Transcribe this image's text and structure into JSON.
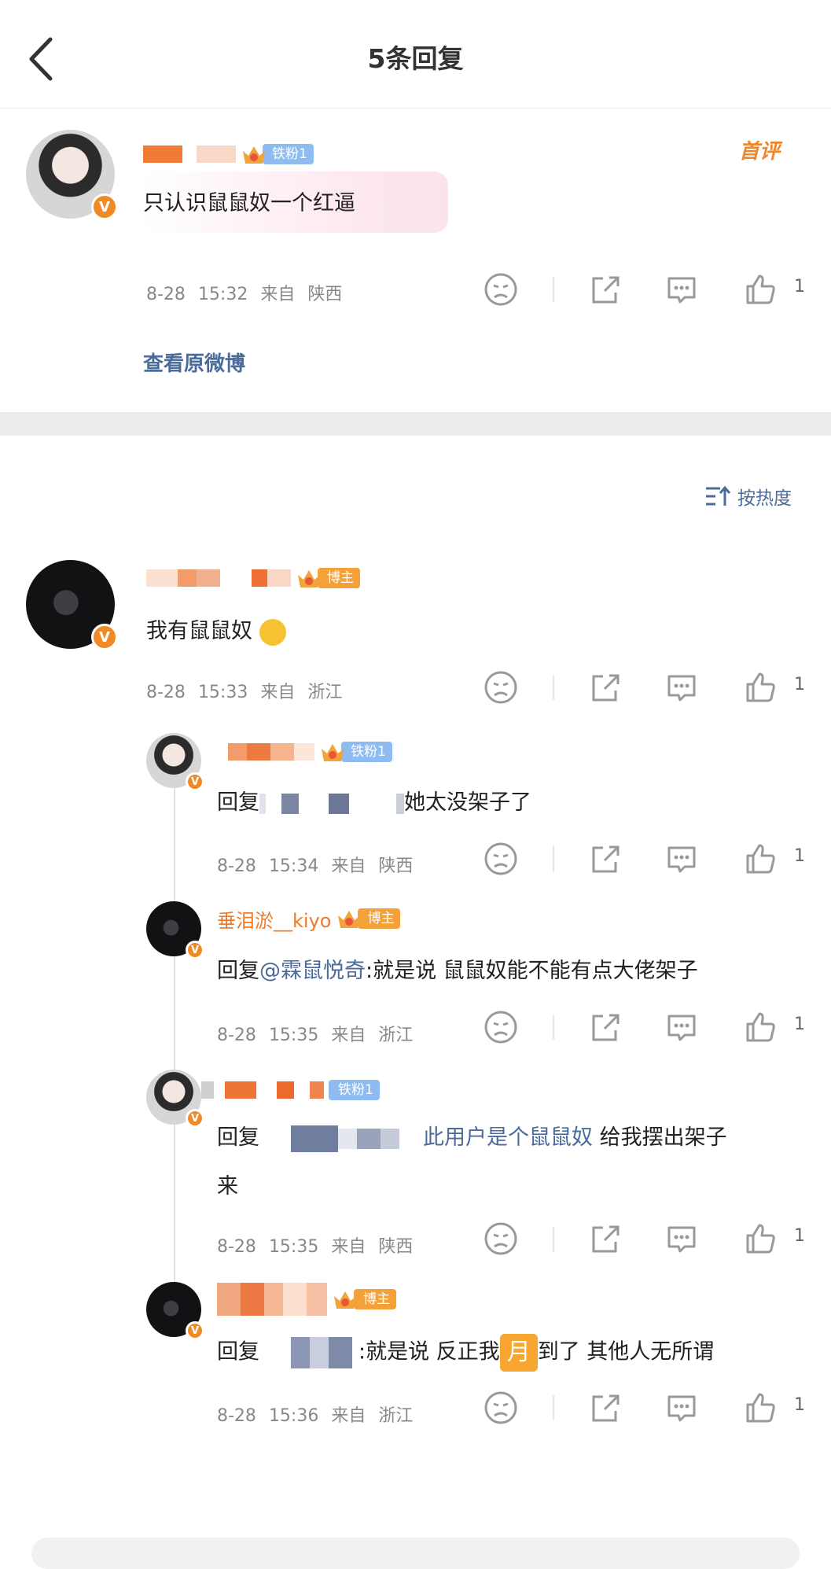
{
  "header": {
    "title": "5条回复"
  },
  "main_comment": {
    "tag": "铁粉1",
    "badge": "首评",
    "text": "只认识鼠鼠奴一个红逼",
    "date": "8-28",
    "time": "15:32",
    "from": "来自",
    "location": "陕西",
    "likes": "1",
    "view_original": "查看原微博"
  },
  "sort": {
    "label": "按热度"
  },
  "replies": [
    {
      "tag": "博主",
      "text": "我有鼠鼠奴",
      "date": "8-28",
      "time": "15:33",
      "from": "来自",
      "location": "浙江",
      "likes": "1"
    },
    {
      "tag": "铁粉1",
      "prefix": "回复",
      "text_tail": "她太没架子了",
      "date": "8-28",
      "time": "15:34",
      "from": "来自",
      "location": "陕西",
      "likes": "1"
    },
    {
      "name": "垂泪淤__kiyo",
      "tag": "博主",
      "prefix": "回复",
      "mention": "@霖鼠悦奇",
      "text_tail": ":就是说  鼠鼠奴能不能有点大佬架子",
      "date": "8-28",
      "time": "15:35",
      "from": "来自",
      "location": "浙江",
      "likes": "1"
    },
    {
      "tag": "铁粉1",
      "prefix": "回复",
      "mention": "此用户是个鼠鼠奴",
      "text_tail": "  给我摆出架子",
      "text_line2": "来",
      "date": "8-28",
      "time": "15:35",
      "from": "来自",
      "location": "陕西",
      "likes": "1"
    },
    {
      "tag": "博主",
      "prefix": "回复",
      "text_mid": ":就是说  反正我",
      "moon": "月",
      "text_tail": "到了  其他人无所谓",
      "date": "8-28",
      "time": "15:36",
      "from": "来自",
      "location": "浙江",
      "likes": "1"
    }
  ],
  "colors": {
    "accent": "#f0862a",
    "link": "#4b6b9a",
    "fan_tag": "#8fbcf0",
    "host_tag": "#f5a13a"
  }
}
